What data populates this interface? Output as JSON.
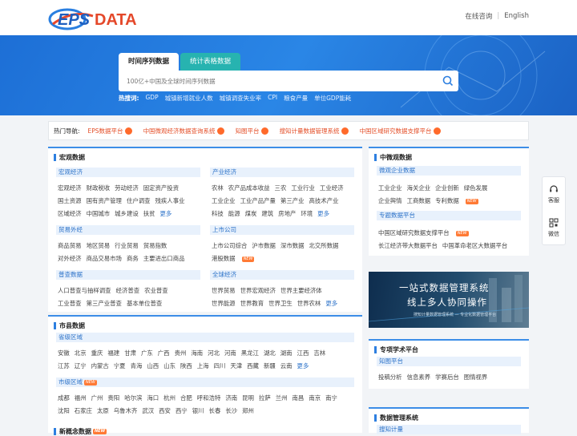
{
  "header": {
    "logo": "EPS DATA",
    "links": [
      "在线咨询",
      "English"
    ]
  },
  "search": {
    "tabs": [
      "时间序列数据",
      "统计表格数据"
    ],
    "placeholder": "100亿+中国及全球时间序列数据",
    "hot_label": "热搜词:",
    "hot_words": [
      "GDP",
      "城镇新增就业人数",
      "城镇调查失业率",
      "CPI",
      "粮食产量",
      "单位GDP能耗"
    ]
  },
  "hotnav": {
    "label": "热门导航:",
    "items": [
      "EPS数据平台",
      "中国微观经济数据查询系统",
      "知图平台",
      "搜知计量数据管理系统",
      "中国区域研究数据支撑平台"
    ]
  },
  "macro": {
    "title": "宏观数据",
    "groups": [
      {
        "title": "宏观经济",
        "rows": [
          [
            "宏观经济",
            "财政税收",
            "劳动经济",
            "固定资产投资"
          ],
          [
            "国土资源",
            "国有资产管理",
            "住户调查",
            "残疾人事业"
          ],
          [
            "区域经济",
            "中国城市",
            "城乡建设",
            "扶贫"
          ]
        ]
      },
      {
        "title": "产业经济",
        "rows": [
          [
            "农林",
            "农产品成本收益",
            "三农",
            "工业行业",
            "工业经济"
          ],
          [
            "工业企业",
            "工业产品产量",
            "第三产业",
            "高技术产业"
          ],
          [
            "科技",
            "能源",
            "煤炭",
            "建筑",
            "房地产",
            "环境"
          ]
        ]
      },
      {
        "title": "贸易外经",
        "rows": [
          [
            "商品贸易",
            "地区贸易",
            "行业贸易",
            "贸易指数"
          ],
          [
            "对外经济",
            "商品交易市场",
            "商务",
            "主要进出口商品"
          ]
        ]
      },
      {
        "title": "上市公司",
        "rows": [
          [
            "上市公司综合",
            "沪市数据",
            "深市数据",
            "北交所数据"
          ],
          [
            "港股数据"
          ]
        ]
      },
      {
        "title": "普查数据",
        "rows": [
          [
            "人口普查与抽样调查",
            "经济普查",
            "农业普查"
          ],
          [
            "工业普查",
            "第三产业普查",
            "基本单位普查"
          ]
        ]
      },
      {
        "title": "全球经济",
        "rows": [
          [
            "世界贸易",
            "世界宏观经济",
            "世界主要经济体"
          ],
          [
            "世界能源",
            "世界教育",
            "世界卫生",
            "世界农林"
          ]
        ]
      }
    ],
    "more": "更多",
    "new_tag": "NEW"
  },
  "city": {
    "title": "市县数据",
    "groups": [
      {
        "title": "省级区域",
        "rows": [
          [
            "安徽",
            "北京",
            "重庆",
            "福建",
            "甘肃",
            "广东",
            "广西",
            "贵州",
            "海南",
            "河北",
            "河南",
            "黑龙江",
            "湖北",
            "湖南",
            "江西",
            "吉林"
          ],
          [
            "江苏",
            "辽宁",
            "内蒙古",
            "宁夏",
            "青海",
            "山西",
            "山东",
            "陕西",
            "上海",
            "四川",
            "天津",
            "西藏",
            "新疆",
            "云南"
          ]
        ]
      },
      {
        "title": "市级区域",
        "rows": [
          [
            "成都",
            "福州",
            "广州",
            "贵阳",
            "哈尔滨",
            "海口",
            "杭州",
            "合肥",
            "呼和浩特",
            "济南",
            "昆明",
            "拉萨",
            "兰州",
            "南昌",
            "南京",
            "南宁"
          ],
          [
            "沈阳",
            "石家庄",
            "太原",
            "乌鲁木齐",
            "武汉",
            "西安",
            "西宁",
            "银川",
            "长春",
            "长沙",
            "郑州"
          ]
        ]
      }
    ],
    "next_title": "新概念数据"
  },
  "micro": {
    "title": "中微观数据",
    "groups": [
      {
        "title": "微观企业数据",
        "rows": [
          [
            "工业企业",
            "海关企业",
            "企业创新",
            "绿色发展"
          ],
          [
            "企业舆情",
            "工商数据",
            "专利数据"
          ]
        ]
      },
      {
        "title": "专题数据平台",
        "rows": [
          [
            "中国区域研究数据支撑平台"
          ],
          [
            "长江经济带大数据平台",
            "中国革命老区大数据平台"
          ]
        ]
      }
    ]
  },
  "promo": {
    "line1": "一站式数据管理系统",
    "line2": "线上多人协同操作",
    "line3": "搜知计量数据管理系统  — 专业化数据管理平台"
  },
  "academic": {
    "title": "专项学术平台",
    "group": "知图平台",
    "items": [
      "投稿分析",
      "信息素养",
      "学赛后台",
      "图情视界"
    ]
  },
  "datamgmt": {
    "title": "数据管理系统",
    "group": "搜知计量"
  },
  "side": {
    "items": [
      "客服",
      "微信"
    ]
  }
}
